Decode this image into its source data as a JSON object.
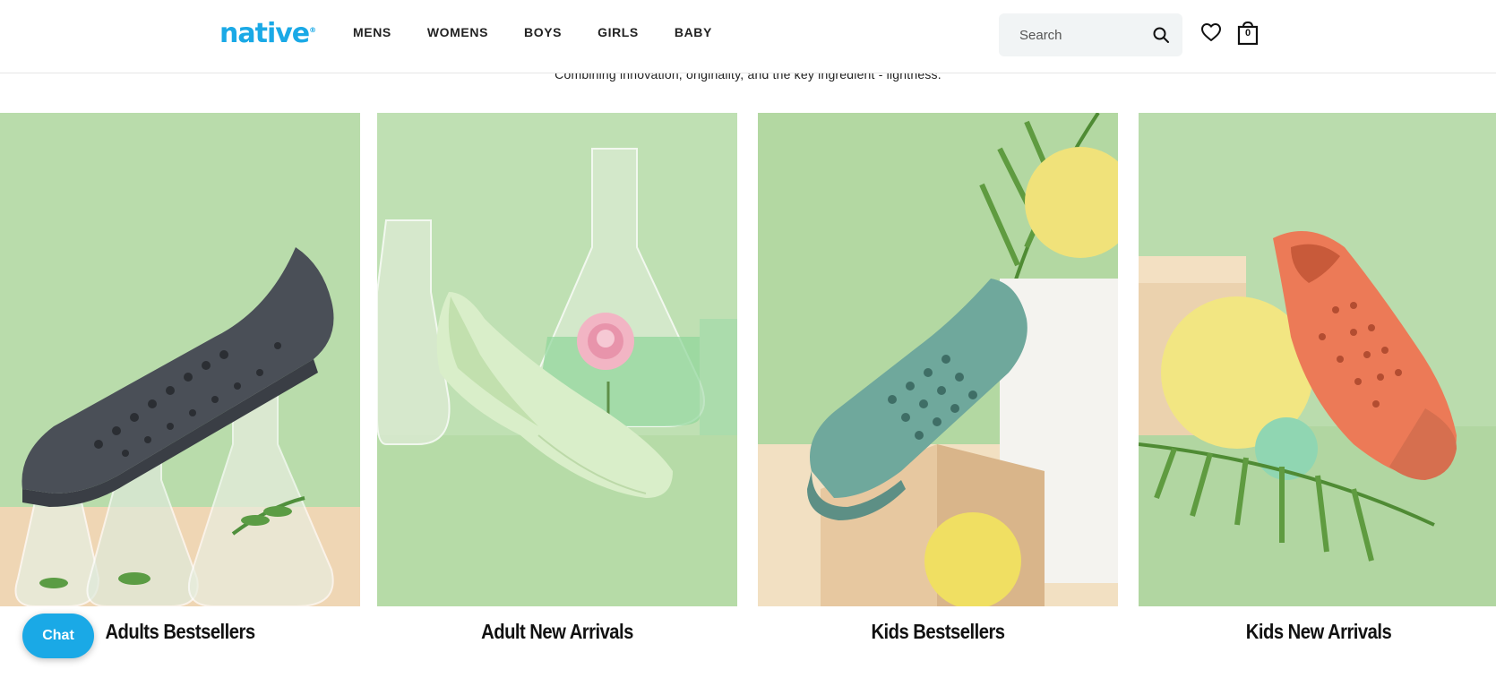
{
  "header": {
    "logo_text": "native",
    "logo_mark": "®",
    "nav": [
      {
        "label": "MENS"
      },
      {
        "label": "WOMENS"
      },
      {
        "label": "BOYS"
      },
      {
        "label": "GIRLS"
      },
      {
        "label": "BABY"
      }
    ],
    "search": {
      "placeholder": "Search",
      "icon": "search-icon"
    },
    "wishlist_icon": "heart-icon",
    "cart": {
      "icon": "shopping-bag-icon",
      "count": "0"
    }
  },
  "tagline": "Combining innovation, originality, and the key ingredient - lightness.",
  "categories": [
    {
      "label": "Adults Bestsellers",
      "image": "dark grey perforated shoe on lab flasks"
    },
    {
      "label": "Adult New Arrivals",
      "image": "mint green flat with pink rose"
    },
    {
      "label": "Kids Bestsellers",
      "image": "teal kids shoe on blocks"
    },
    {
      "label": "Kids New Arrivals",
      "image": "coral kids shoe with yellow ball"
    }
  ],
  "chat": {
    "label": "Chat"
  },
  "colors": {
    "brand": "#1aa9e6",
    "card_bg": "#b7dbaa",
    "text": "#111111"
  }
}
